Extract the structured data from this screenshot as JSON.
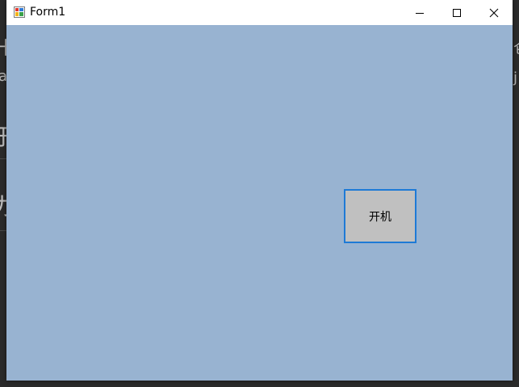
{
  "window": {
    "title": "Form1",
    "client_color": "#98b3d1",
    "titlebar_color": "#ffffff",
    "controls": {
      "minimize_icon": "minimize-icon",
      "maximize_icon": "maximize-icon",
      "close_icon": "close-icon"
    }
  },
  "form": {
    "power_button_label": "开机",
    "power_button_color": "#c0c0c0",
    "focus_border_color": "#1e7ad6"
  },
  "background": {
    "fragments": [
      "十",
      "a",
      "于",
      "订",
      "力",
      "仑",
      "j"
    ]
  }
}
